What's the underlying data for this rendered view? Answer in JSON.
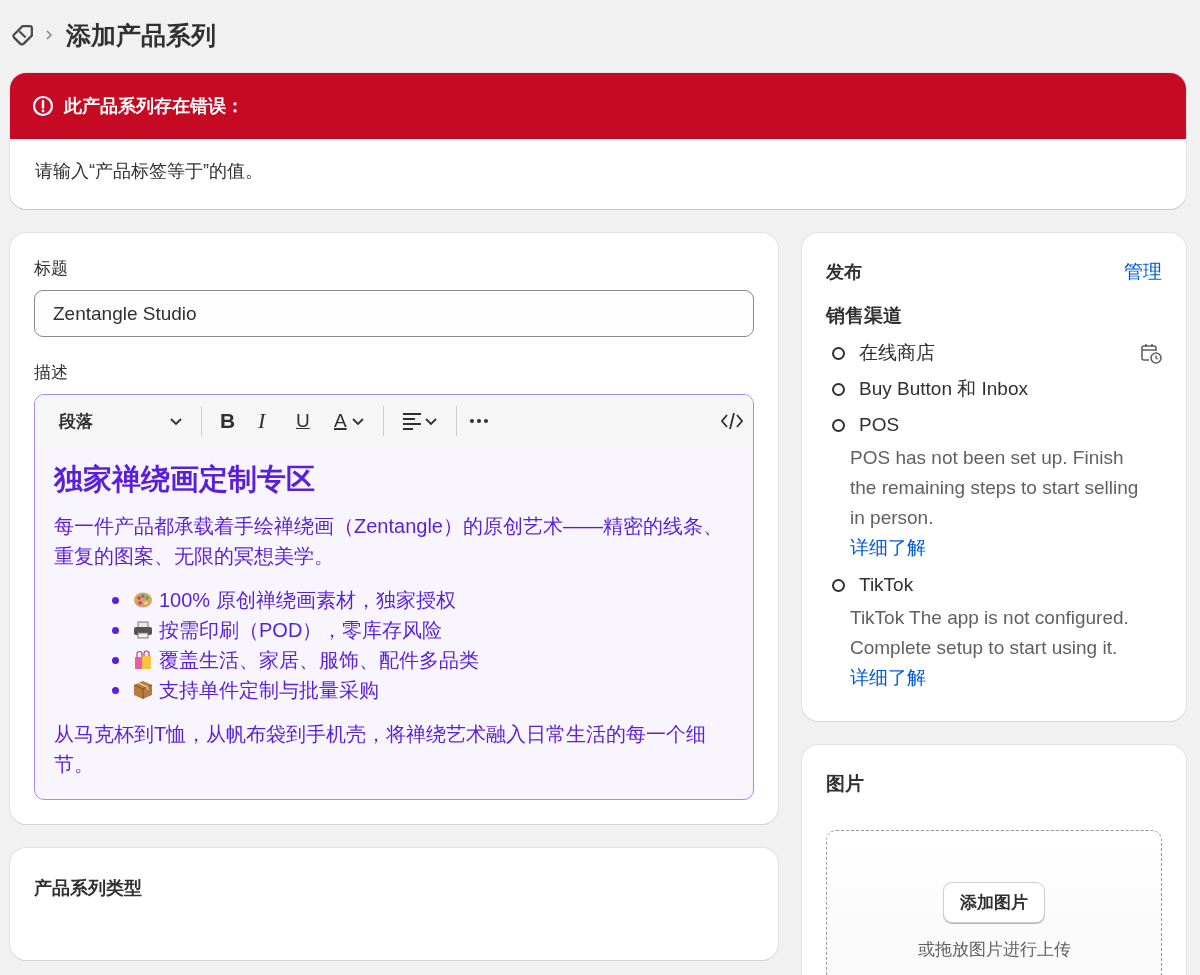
{
  "breadcrumb": {
    "title": "添加产品系列"
  },
  "error_banner": {
    "title": "此产品系列存在错误：",
    "message": "请输入“产品标签等于”的值。"
  },
  "title_field": {
    "label": "标题",
    "value": "Zentangle Studio"
  },
  "description": {
    "label": "描述",
    "toolbar": {
      "format": "段落",
      "buttons": [
        {
          "kind": "bold",
          "label": "B"
        },
        {
          "kind": "italic",
          "label": "I"
        },
        {
          "kind": "underline",
          "label": "U"
        },
        {
          "kind": "color",
          "label": "A"
        }
      ]
    },
    "heading": "独家禅绕画定制专区",
    "intro": "每一件产品都承载着手绘禅绕画（Zentangle）的原创艺术——精密的线条、重复的图案、无限的冥想美学。",
    "bullets": [
      {
        "kind": "palette",
        "text": "100% 原创禅绕画素材，独家授权"
      },
      {
        "kind": "printer",
        "text": "按需印刷（POD），零库存风险"
      },
      {
        "kind": "bags",
        "text": "覆盖生活、家居、服饰、配件多品类"
      },
      {
        "kind": "package",
        "text": "支持单件定制与批量采购"
      }
    ],
    "outro": "从马克杯到T恤，从帆布袋到手机壳，将禅绕艺术融入日常生活的每一个细节。"
  },
  "collection_type": {
    "title": "产品系列类型"
  },
  "publishing": {
    "title": "发布",
    "manage_link": "管理",
    "sales_channels_title": "销售渠道",
    "channels": [
      {
        "name": "在线商店",
        "published": false,
        "scheduled": true
      },
      {
        "name": "Buy Button 和 Inbox",
        "published": false,
        "scheduled": false
      },
      {
        "name": "POS",
        "published": false,
        "scheduled": false,
        "note": "POS has not been set up. Finish the remaining steps to start selling in person.",
        "learn_more": "详细了解"
      },
      {
        "name": "TikTok",
        "published": false,
        "scheduled": false,
        "note": "TikTok The app is not configured. Complete setup to start using it.",
        "learn_more": "详细了解"
      }
    ]
  },
  "images": {
    "title": "图片",
    "button": "添加图片",
    "hint": "或拖放图片进行上传"
  }
}
